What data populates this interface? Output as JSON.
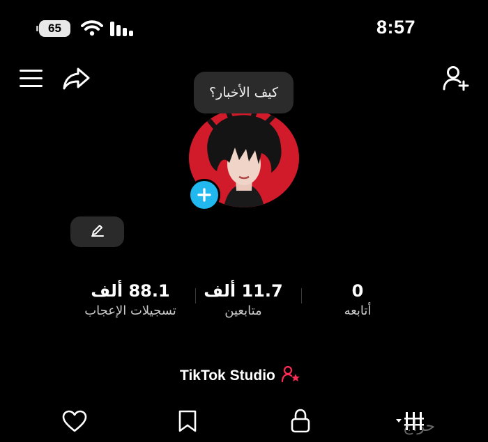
{
  "status_bar": {
    "time": "8:57",
    "battery_level": "65"
  },
  "tooltip": {
    "text": "كيف الأخبار؟"
  },
  "stats": [
    {
      "value": "88.1 ألف",
      "label": "تسجيلات الإعجاب"
    },
    {
      "value": "11.7 ألف",
      "label": "متابعين"
    },
    {
      "value": "0",
      "label": "أتابعه"
    }
  ],
  "studio": {
    "label": "TikTok Studio"
  },
  "watermark": {
    "text": "حراج"
  },
  "colors": {
    "background": "#000000",
    "add_badge": "#20b8ef",
    "avatar_bg": "#d11a2a",
    "studio_star": "#fe2c55"
  },
  "icons": {
    "menu": "menu-icon",
    "share": "share-icon",
    "add_user": "add-user-icon",
    "edit": "pencil-icon",
    "heart": "heart-icon",
    "bookmark": "bookmark-icon",
    "lock": "lock-icon",
    "grid": "grid-icon"
  }
}
